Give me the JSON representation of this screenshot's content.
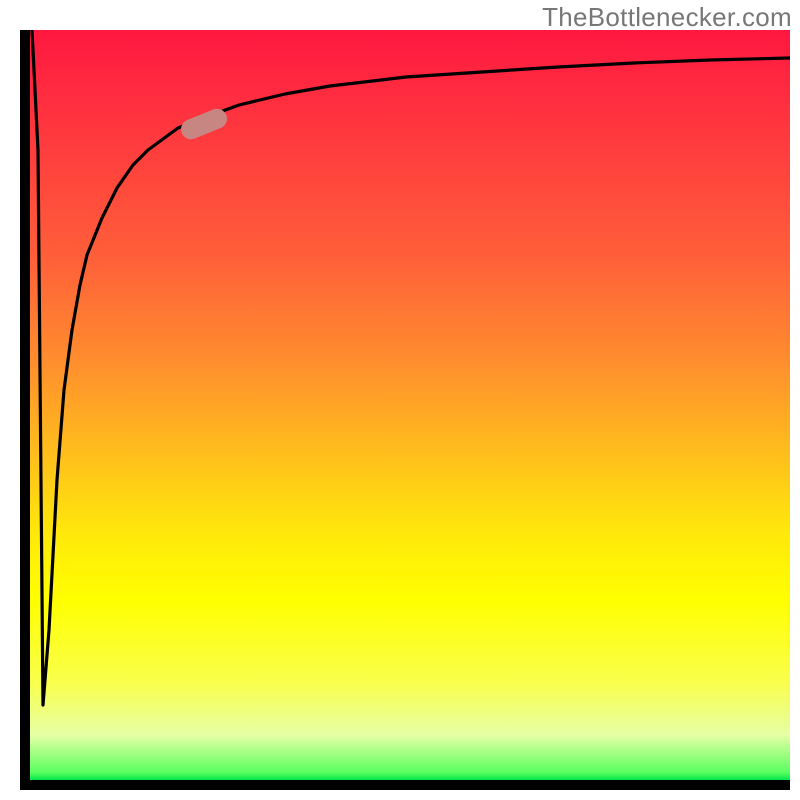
{
  "watermark": "TheBottlenecker.com",
  "colors": {
    "axis": "#000000",
    "curve": "#000000",
    "marker": "#c88682",
    "gradient_top": "#ff173f",
    "gradient_mid": "#ffff00",
    "gradient_bottom": "#00e54a"
  },
  "chart_data": {
    "type": "line",
    "title": "",
    "xlabel": "",
    "ylabel": "",
    "xlim": [
      0,
      100
    ],
    "ylim": [
      0,
      100
    ],
    "legend": false,
    "grid": false,
    "annotations": [
      {
        "name": "marker",
        "x": 24,
        "y": 88,
        "shape": "rounded-pill",
        "color": "#c88682"
      }
    ],
    "series": [
      {
        "name": "bottleneck-curve",
        "color": "#000000",
        "x": [
          0,
          1,
          2,
          3,
          4,
          5,
          6,
          7,
          8,
          10,
          12,
          14,
          16,
          18,
          20,
          24,
          28,
          34,
          40,
          50,
          60,
          70,
          80,
          90,
          100
        ],
        "y": [
          100,
          84,
          10,
          20,
          40,
          52,
          60,
          66,
          70,
          75,
          79,
          82,
          84,
          85.5,
          87,
          88.5,
          90,
          91.5,
          92.5,
          93.7,
          94.5,
          95.1,
          95.6,
          96.0,
          96.3
        ]
      }
    ]
  }
}
